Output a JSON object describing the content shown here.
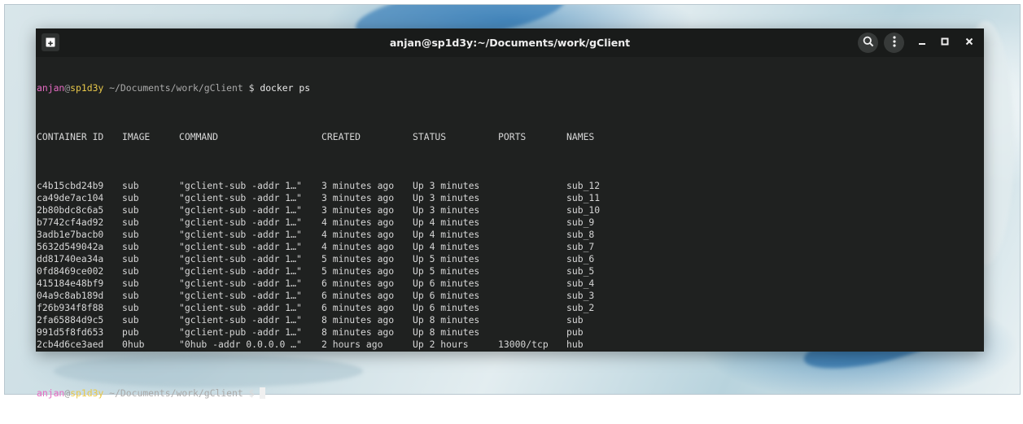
{
  "window": {
    "title": "anjan@sp1d3y:~/Documents/work/gClient",
    "buttons": {
      "new_tab_icon": "new-tab-icon",
      "search_icon": "search-icon",
      "menu_icon": "kebab-menu-icon",
      "minimize_label": "–",
      "maximize_label": "▫",
      "close_label": "✕"
    }
  },
  "prompt": {
    "user": "anjan",
    "at": "@",
    "host": "sp1d3y",
    "path": " ~/Documents/work/gClient",
    "dollar": " $ "
  },
  "command": "docker ps",
  "table": {
    "headers": {
      "id": "CONTAINER ID",
      "image": "IMAGE",
      "command": "COMMAND",
      "created": "CREATED",
      "status": "STATUS",
      "ports": "PORTS",
      "names": "NAMES"
    },
    "rows": [
      {
        "id": "c4b15cbd24b9",
        "image": "sub",
        "command": "\"gclient-sub -addr 1…\"",
        "created": "3 minutes ago",
        "status": "Up 3 minutes",
        "ports": "",
        "names": "sub_12"
      },
      {
        "id": "ca49de7ac104",
        "image": "sub",
        "command": "\"gclient-sub -addr 1…\"",
        "created": "3 minutes ago",
        "status": "Up 3 minutes",
        "ports": "",
        "names": "sub_11"
      },
      {
        "id": "2b80bdc8c6a5",
        "image": "sub",
        "command": "\"gclient-sub -addr 1…\"",
        "created": "3 minutes ago",
        "status": "Up 3 minutes",
        "ports": "",
        "names": "sub_10"
      },
      {
        "id": "b7742cf4ad92",
        "image": "sub",
        "command": "\"gclient-sub -addr 1…\"",
        "created": "4 minutes ago",
        "status": "Up 4 minutes",
        "ports": "",
        "names": "sub_9"
      },
      {
        "id": "3adb1e7bacb0",
        "image": "sub",
        "command": "\"gclient-sub -addr 1…\"",
        "created": "4 minutes ago",
        "status": "Up 4 minutes",
        "ports": "",
        "names": "sub_8"
      },
      {
        "id": "5632d549042a",
        "image": "sub",
        "command": "\"gclient-sub -addr 1…\"",
        "created": "4 minutes ago",
        "status": "Up 4 minutes",
        "ports": "",
        "names": "sub_7"
      },
      {
        "id": "dd81740ea34a",
        "image": "sub",
        "command": "\"gclient-sub -addr 1…\"",
        "created": "5 minutes ago",
        "status": "Up 5 minutes",
        "ports": "",
        "names": "sub_6"
      },
      {
        "id": "0fd8469ce002",
        "image": "sub",
        "command": "\"gclient-sub -addr 1…\"",
        "created": "5 minutes ago",
        "status": "Up 5 minutes",
        "ports": "",
        "names": "sub_5"
      },
      {
        "id": "415184e48bf9",
        "image": "sub",
        "command": "\"gclient-sub -addr 1…\"",
        "created": "6 minutes ago",
        "status": "Up 6 minutes",
        "ports": "",
        "names": "sub_4"
      },
      {
        "id": "04a9c8ab189d",
        "image": "sub",
        "command": "\"gclient-sub -addr 1…\"",
        "created": "6 minutes ago",
        "status": "Up 6 minutes",
        "ports": "",
        "names": "sub_3"
      },
      {
        "id": "f26b934f8f88",
        "image": "sub",
        "command": "\"gclient-sub -addr 1…\"",
        "created": "6 minutes ago",
        "status": "Up 6 minutes",
        "ports": "",
        "names": "sub_2"
      },
      {
        "id": "2fa65884d9c5",
        "image": "sub",
        "command": "\"gclient-sub -addr 1…\"",
        "created": "8 minutes ago",
        "status": "Up 8 minutes",
        "ports": "",
        "names": "sub"
      },
      {
        "id": "991d5f8fd653",
        "image": "pub",
        "command": "\"gclient-pub -addr 1…\"",
        "created": "8 minutes ago",
        "status": "Up 8 minutes",
        "ports": "",
        "names": "pub"
      },
      {
        "id": "2cb4d6ce3aed",
        "image": "0hub",
        "command": "\"0hub -addr 0.0.0.0 …\"",
        "created": "2 hours ago",
        "status": "Up 2 hours",
        "ports": "13000/tcp",
        "names": "hub"
      }
    ]
  },
  "colors": {
    "terminal_bg": "#1f2120",
    "titlebar_bg": "#191b1a",
    "prompt_user": "#e56bc2",
    "prompt_host": "#e8c84a",
    "text": "#d6d6d6"
  }
}
